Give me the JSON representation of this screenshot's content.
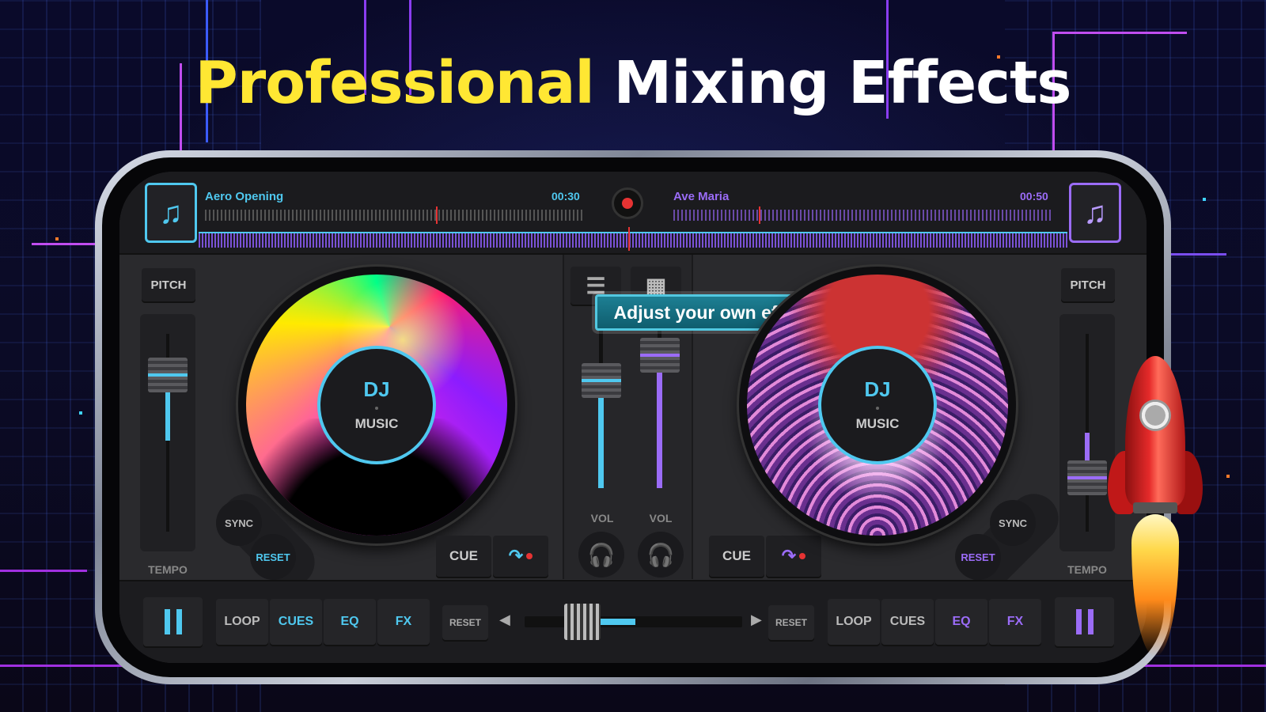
{
  "headline": {
    "part1": "Professional",
    "part2": "Mixing Effects"
  },
  "colors": {
    "accent_blue": "#4fc8ef",
    "accent_purple": "#9b6cf7",
    "headline_yellow": "#ffe733",
    "record_red": "#e63333"
  },
  "deck_a": {
    "track_title": "Aero Opening",
    "time": "00:30",
    "music_button_icon": "music-note-icon",
    "pitch_label": "PITCH",
    "tempo_label": "TEMPO",
    "platter_label_top": "DJ",
    "platter_label_bottom": "MUSIC",
    "sync_label": "SYNC",
    "reset_label": "RESET",
    "cue_label": "CUE"
  },
  "deck_b": {
    "track_title": "Ave Maria",
    "time": "00:50",
    "music_button_icon": "music-note-icon",
    "pitch_label": "PITCH",
    "tempo_label": "TEMPO",
    "platter_label_top": "DJ",
    "platter_label_bottom": "MUSIC",
    "sync_label": "SYNC",
    "reset_label": "RESET",
    "cue_label": "CUE"
  },
  "mixer": {
    "menu_icon": "hamburger-icon",
    "grid_icon": "grid-icon",
    "tooltip": "Adjust your own effect",
    "vol_left_label": "VOL",
    "vol_right_label": "VOL",
    "headphone_icon": "headphones-icon"
  },
  "bottom": {
    "left": {
      "loop": "LOOP",
      "cues": "CUES",
      "eq": "EQ",
      "fx": "FX",
      "reset": "RESET"
    },
    "right": {
      "loop": "LOOP",
      "cues": "CUES",
      "eq": "EQ",
      "fx": "FX",
      "reset": "RESET"
    },
    "pause_icon": "pause-icon"
  }
}
